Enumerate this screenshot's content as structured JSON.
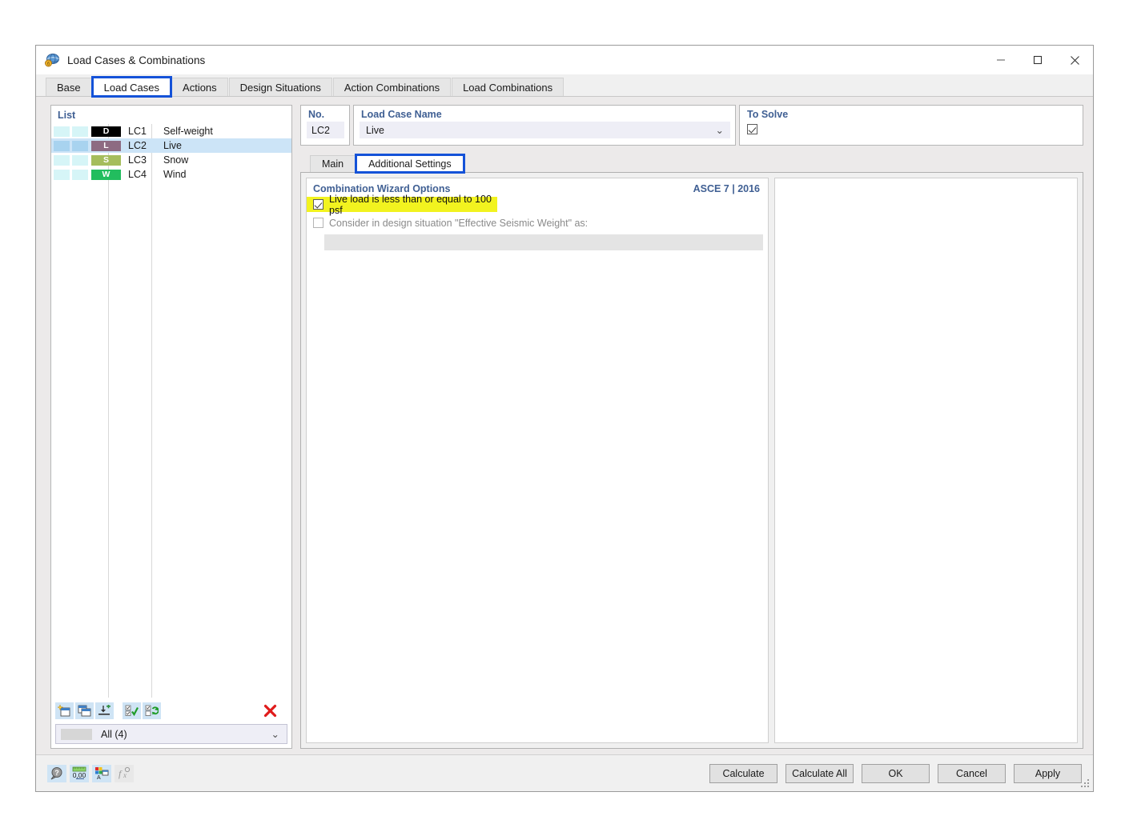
{
  "window": {
    "title": "Load Cases & Combinations",
    "icon": "app-globe-icon",
    "minimize": "─",
    "maximize": "□",
    "close": "✕"
  },
  "tabs": [
    {
      "label": "Base",
      "active": false,
      "highlighted": false
    },
    {
      "label": "Load Cases",
      "active": true,
      "highlighted": true
    },
    {
      "label": "Actions",
      "active": false,
      "highlighted": false
    },
    {
      "label": "Design Situations",
      "active": false,
      "highlighted": false
    },
    {
      "label": "Action Combinations",
      "active": false,
      "highlighted": false
    },
    {
      "label": "Load Combinations",
      "active": false,
      "highlighted": false
    }
  ],
  "list": {
    "header": "List",
    "rows": [
      {
        "badge": "D",
        "badge_color": "#000000",
        "no": "LC1",
        "name": "Self-weight",
        "selected": false
      },
      {
        "badge": "L",
        "badge_color": "#8d6b82",
        "no": "LC2",
        "name": "Live",
        "selected": true
      },
      {
        "badge": "S",
        "badge_color": "#a5bd5c",
        "no": "LC3",
        "name": "Snow",
        "selected": false
      },
      {
        "badge": "W",
        "badge_color": "#22bd5e",
        "no": "LC4",
        "name": "Wind",
        "selected": false
      }
    ],
    "toolbar": [
      {
        "name": "new-load-case-button",
        "glyph": "new"
      },
      {
        "name": "copy-load-case-button",
        "glyph": "copy"
      },
      {
        "name": "import-load-case-button",
        "glyph": "import"
      },
      {
        "name": "select-all-button",
        "glyph": "checkall"
      },
      {
        "name": "invert-selection-button",
        "glyph": "toggleall"
      }
    ],
    "delete_button": "✕",
    "filter": {
      "value": "All (4)",
      "arrow": "⌄"
    }
  },
  "fields": {
    "no_label": "No.",
    "no_value": "LC2",
    "name_label": "Load Case Name",
    "name_value": "Live",
    "name_arrow": "⌄",
    "solve_label": "To Solve",
    "solve_checked": true
  },
  "subtabs": [
    {
      "label": "Main",
      "active": false,
      "highlighted": false
    },
    {
      "label": "Additional Settings",
      "active": true,
      "highlighted": true
    }
  ],
  "wizard": {
    "title": "Combination Wizard Options",
    "standard": "ASCE 7 | 2016",
    "option1": {
      "label": "Live load is less than or equal to 100 psf",
      "checked": true,
      "highlight_color": "#f2f31f"
    },
    "option2": {
      "label": "Consider in design situation \"Effective Seismic Weight\" as:",
      "checked": false,
      "disabled": true
    },
    "seismic_input_value": ""
  },
  "footer": {
    "icons": [
      {
        "name": "help-search-icon",
        "glyph": "help",
        "disabled": false
      },
      {
        "name": "number-format-icon",
        "glyph": "number",
        "label": "0,00",
        "disabled": false
      },
      {
        "name": "display-properties-icon",
        "glyph": "colors",
        "disabled": false
      },
      {
        "name": "formula-icon",
        "glyph": "fx",
        "disabled": true
      }
    ],
    "buttons": [
      {
        "label": "Calculate",
        "name": "calculate-button"
      },
      {
        "label": "Calculate All",
        "name": "calculate-all-button"
      },
      {
        "label": "OK",
        "name": "ok-button"
      },
      {
        "label": "Cancel",
        "name": "cancel-button"
      },
      {
        "label": "Apply",
        "name": "apply-button"
      }
    ]
  }
}
